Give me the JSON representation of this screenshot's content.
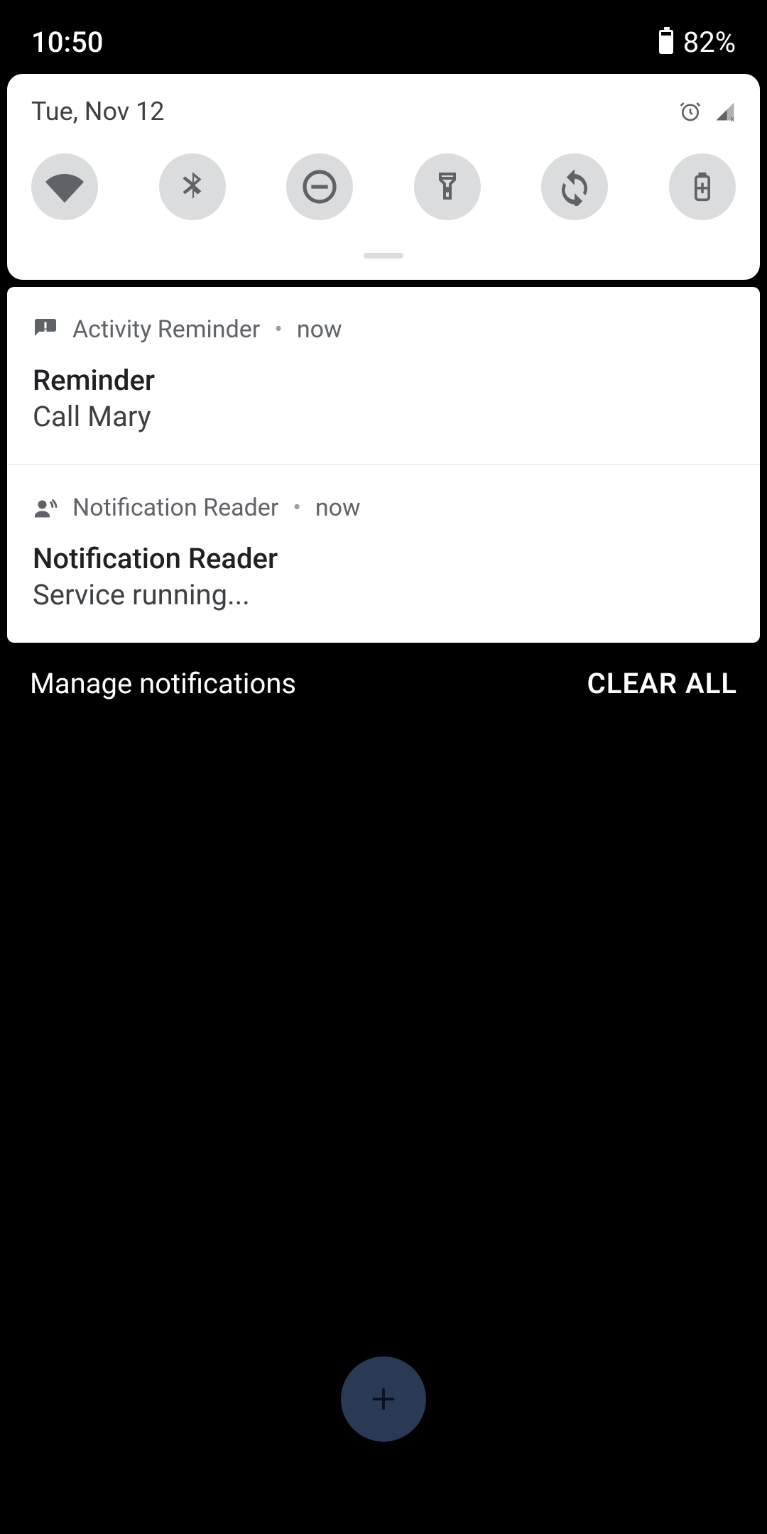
{
  "statusbar": {
    "time": "10:50",
    "battery": "82%"
  },
  "qs_panel": {
    "date": "Tue, Nov 12",
    "tiles": [
      "wifi",
      "bluetooth",
      "dnd",
      "flashlight",
      "autorotate",
      "battery-saver"
    ]
  },
  "notifications": [
    {
      "icon": "feedback",
      "app": "Activity Reminder",
      "time": "now",
      "title": "Reminder",
      "body": "Call Mary"
    },
    {
      "icon": "voice",
      "app": "Notification Reader",
      "time": "now",
      "title": "Notification Reader",
      "body": "Service running..."
    }
  ],
  "actions": {
    "manage": "Manage notifications",
    "clear": "CLEAR ALL"
  }
}
